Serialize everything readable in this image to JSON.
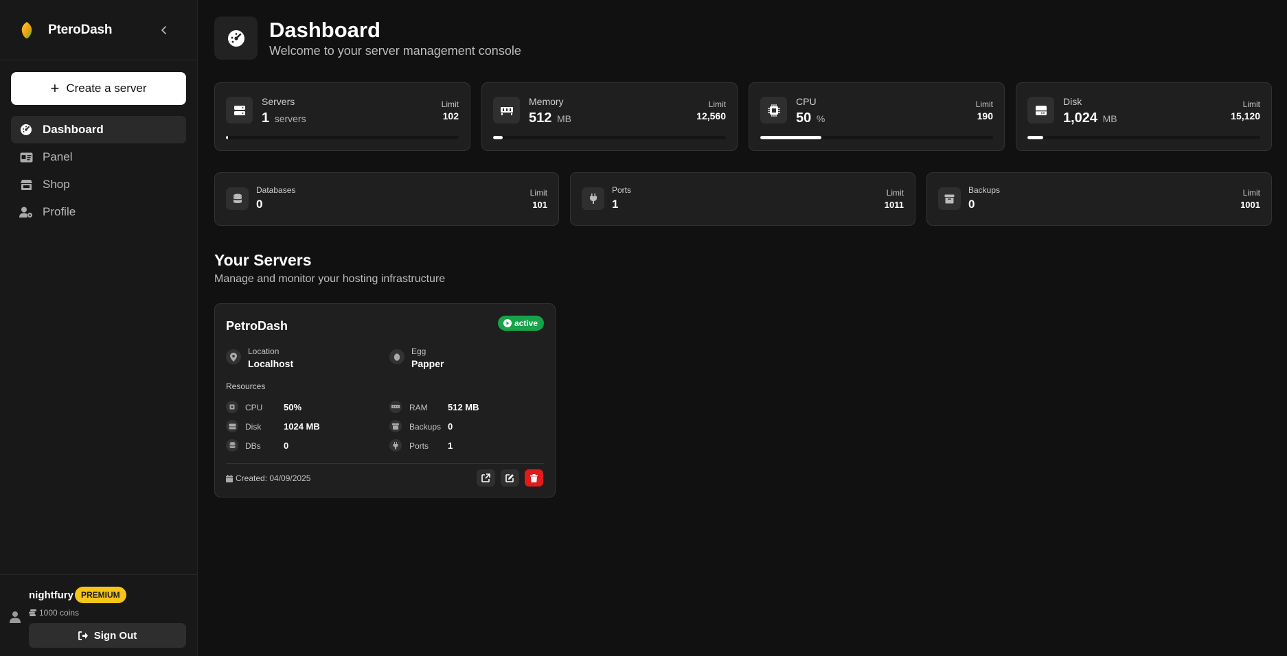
{
  "sidebar": {
    "brand": "PteroDash",
    "create_label": "Create a server",
    "nav": [
      {
        "label": "Dashboard",
        "icon": "gauge-icon",
        "active": true
      },
      {
        "label": "Panel",
        "icon": "id-card-icon",
        "active": false
      },
      {
        "label": "Shop",
        "icon": "store-icon",
        "active": false
      },
      {
        "label": "Profile",
        "icon": "user-gear-icon",
        "active": false
      }
    ],
    "user": {
      "name": "nightfury",
      "badge": "PREMIUM",
      "coins": "1000 coins",
      "signout_label": "Sign Out"
    }
  },
  "header": {
    "title": "Dashboard",
    "subtitle": "Welcome to your server management console"
  },
  "stats": [
    {
      "label": "Servers",
      "value": "1",
      "unit": "servers",
      "limit_label": "Limit",
      "limit": "102",
      "usage": 0.0098,
      "icon": "server-icon"
    },
    {
      "label": "Memory",
      "value": "512",
      "unit": "MB",
      "limit_label": "Limit",
      "limit": "12,560",
      "usage": 0.041,
      "icon": "memory-icon"
    },
    {
      "label": "CPU",
      "value": "50",
      "unit": "%",
      "limit_label": "Limit",
      "limit": "190",
      "usage": 0.263,
      "icon": "cpu-icon"
    },
    {
      "label": "Disk",
      "value": "1,024",
      "unit": "MB",
      "limit_label": "Limit",
      "limit": "15,120",
      "usage": 0.068,
      "icon": "hard-drive-icon"
    }
  ],
  "resources": [
    {
      "label": "Databases",
      "value": "0",
      "limit_label": "Limit",
      "limit": "101",
      "icon": "database-icon"
    },
    {
      "label": "Ports",
      "value": "1",
      "limit_label": "Limit",
      "limit": "1011",
      "icon": "plug-icon"
    },
    {
      "label": "Backups",
      "value": "0",
      "limit_label": "Limit",
      "limit": "1001",
      "icon": "archive-icon"
    }
  ],
  "servers_section": {
    "title": "Your Servers",
    "subtitle": "Manage and monitor your hosting infrastructure"
  },
  "server": {
    "name": "PetroDash",
    "status": "active",
    "location_label": "Location",
    "location": "Localhost",
    "egg_label": "Egg",
    "egg": "Papper",
    "resources_label": "Resources",
    "cpu_label": "CPU",
    "cpu": "50%",
    "ram_label": "RAM",
    "ram": "512 MB",
    "disk_label": "Disk",
    "disk": "1024 MB",
    "backups_label": "Backups",
    "backups": "0",
    "dbs_label": "DBs",
    "dbs": "0",
    "ports_label": "Ports",
    "ports": "1",
    "created": "Created: 04/09/2025"
  },
  "colors": {
    "background": "#111111",
    "sidebar": "#181818",
    "card": "#1f1f1f",
    "active_status": "#16a34a",
    "premium": "#f5c518",
    "delete": "#e01b1b"
  }
}
